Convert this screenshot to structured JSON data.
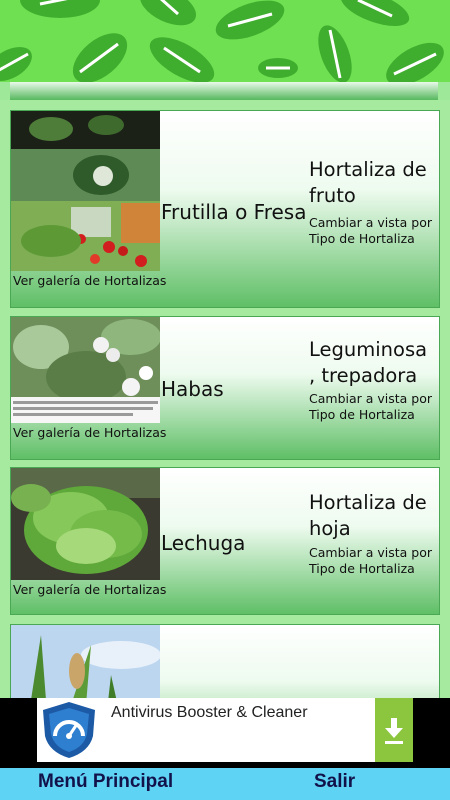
{
  "cards": [
    {
      "name": "Frutilla o Fresa",
      "type": "Hortaliza de fruto",
      "change_view": "Cambiar a vista por Tipo de Hortaliza",
      "gallery_link": "Ver galería de Hortalizas",
      "image": "strawberry-photo"
    },
    {
      "name": "Habas",
      "type": "Leguminosa , trepadora",
      "change_view": "Cambiar a vista por Tipo de Hortaliza",
      "gallery_link": "Ver galería de Hortalizas",
      "image": "fava-bean-photo"
    },
    {
      "name": "Lechuga",
      "type": "Hortaliza de hoja",
      "change_view": "Cambiar a vista por Tipo de Hortaliza",
      "gallery_link": "Ver galería de Hortalizas",
      "image": "lettuce-photo"
    },
    {
      "name": "",
      "type": "",
      "change_view": "",
      "gallery_link": "",
      "image": "corn-photo"
    }
  ],
  "ad": {
    "title": "Antivirus Booster & Cleaner",
    "icon": "shield-speedometer-icon",
    "action_icon": "download-icon"
  },
  "bottom_bar": {
    "menu_label": "Menú Principal",
    "exit_label": "Salir"
  },
  "colors": {
    "header": "#6fe052",
    "list_bg": "#a6ea9f",
    "card_bottom": "#5fbf66",
    "bottom_bar": "#5fd3f3",
    "bottom_text": "#12124a"
  }
}
